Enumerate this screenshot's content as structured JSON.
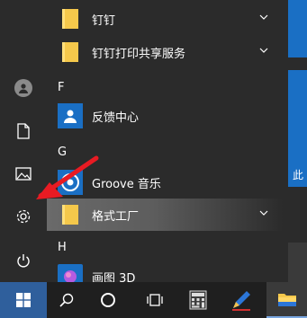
{
  "sections": [
    {
      "header": "",
      "items": [
        {
          "label": "钉钉",
          "icon": "folder-icon",
          "expandable": true
        },
        {
          "label": "钉钉打印共享服务",
          "icon": "folder-icon",
          "expandable": true
        }
      ]
    },
    {
      "header": "F",
      "items": [
        {
          "label": "反馈中心",
          "icon": "feedback-person-icon",
          "expandable": false
        }
      ]
    },
    {
      "header": "G",
      "items": [
        {
          "label": "Groove 音乐",
          "icon": "groove-music-icon",
          "expandable": false
        },
        {
          "label": "格式工厂",
          "icon": "folder-icon",
          "expandable": true,
          "highlighted": true
        }
      ]
    },
    {
      "header": "H",
      "items": [
        {
          "label": "画图 3D",
          "icon": "paint-3d-icon",
          "expandable": false
        }
      ]
    }
  ],
  "rail": [
    "user-account-icon",
    "documents-icon",
    "pictures-icon",
    "settings-icon",
    "power-icon"
  ],
  "tile_text": "此",
  "taskbar": [
    "windows-start-icon",
    "search-icon",
    "cortana-icon",
    "task-view-icon",
    "calculator-icon",
    "pen-app-icon",
    "file-explorer-icon"
  ],
  "colors": {
    "accent": "#1a6fc4",
    "folder": "#f5c84b",
    "arrow": "#e81b23"
  }
}
